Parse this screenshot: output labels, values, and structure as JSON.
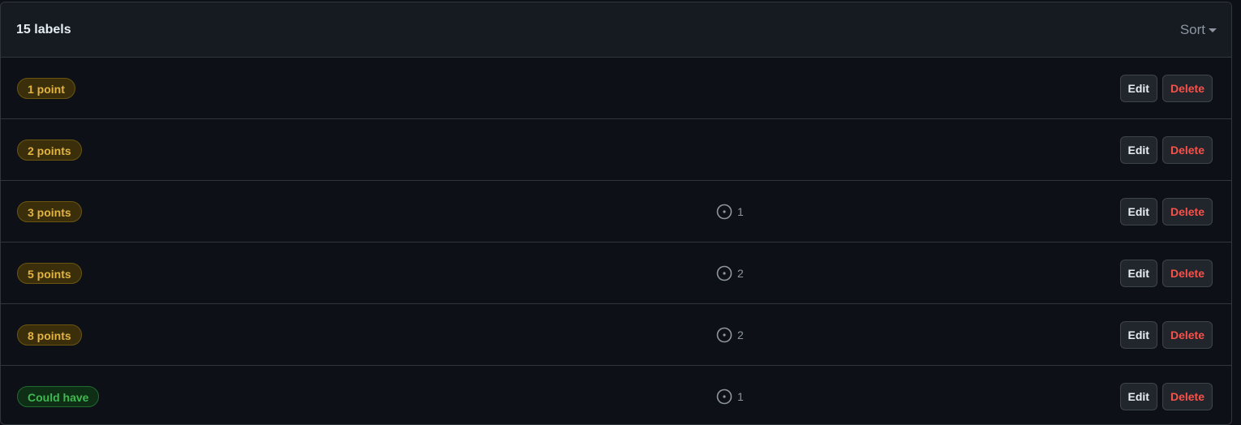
{
  "header": {
    "count_text": "15 labels",
    "sort_label": "Sort"
  },
  "labels": [
    {
      "name": "1 point",
      "issues": "",
      "edit": "Edit",
      "delete": "Delete",
      "color": "#e3b341"
    },
    {
      "name": "2 points",
      "issues": "",
      "edit": "Edit",
      "delete": "Delete",
      "color": "#e3b341"
    },
    {
      "name": "3 points",
      "issues": "1",
      "edit": "Edit",
      "delete": "Delete",
      "color": "#e3b341"
    },
    {
      "name": "5 points",
      "issues": "2",
      "edit": "Edit",
      "delete": "Delete",
      "color": "#e3b341"
    },
    {
      "name": "8 points",
      "issues": "2",
      "edit": "Edit",
      "delete": "Delete",
      "color": "#e3b341"
    },
    {
      "name": "Could have",
      "issues": "1",
      "edit": "Edit",
      "delete": "Delete",
      "color": "#3fb950"
    }
  ],
  "icons": {
    "issue": "issue-opened-icon",
    "sort": "caret-down-icon"
  }
}
